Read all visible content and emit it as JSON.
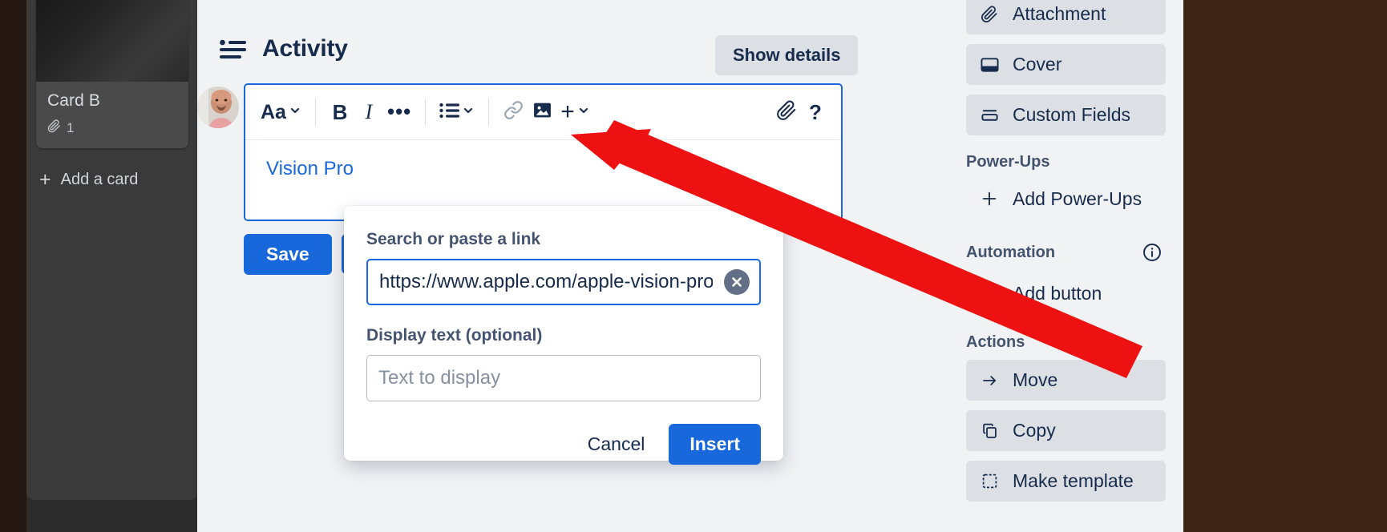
{
  "board": {
    "card": {
      "title": "Card B",
      "attachment_count": "1",
      "attachment_icon": "paperclip-icon"
    },
    "add_card_label": "Add a card",
    "add_icon": "plus-icon"
  },
  "activity": {
    "icon": "activity-list-icon",
    "title": "Activity",
    "show_details_label": "Show details"
  },
  "composer": {
    "avatar_name": "user-avatar",
    "toolbar": {
      "text_style_label": "Aa",
      "bold_label": "B",
      "italic_label": "I",
      "more_label": "•••",
      "list_icon": "bullet-list-icon",
      "link_icon": "link-icon",
      "image_icon": "image-icon",
      "plus_label": "+",
      "attachment_icon": "paperclip-icon",
      "help_label": "?",
      "chevron_icon": "chevron-down-icon"
    },
    "body_text": "Vision Pro",
    "save_label": "Save",
    "confirm_icon": "check-icon"
  },
  "link_popover": {
    "url_label": "Search or paste a link",
    "url_value": "https://www.apple.com/apple-vision-pro/",
    "url_placeholder": "Search or paste a link",
    "clear_icon": "clear-x-icon",
    "display_label": "Display text (optional)",
    "display_value": "",
    "display_placeholder": "Text to display",
    "cancel_label": "Cancel",
    "insert_label": "Insert"
  },
  "sidebar": {
    "items": [
      {
        "label": "Attachment",
        "icon": "paperclip-icon"
      },
      {
        "label": "Cover",
        "icon": "cover-icon"
      },
      {
        "label": "Custom Fields",
        "icon": "custom-fields-icon"
      }
    ],
    "power_ups": {
      "heading": "Power-Ups",
      "add_label": "Add Power-Ups",
      "add_icon": "plus-icon"
    },
    "automation": {
      "heading": "Automation",
      "info_icon": "info-icon",
      "add_label": "Add button",
      "add_icon": "plus-icon"
    },
    "actions": {
      "heading": "Actions",
      "items": [
        {
          "label": "Move",
          "icon": "arrow-right-icon"
        },
        {
          "label": "Copy",
          "icon": "copy-icon"
        },
        {
          "label": "Make template",
          "icon": "template-icon"
        }
      ]
    }
  },
  "annotation": {
    "arrow_color": "#ee1111",
    "arrow_name": "red-pointer-arrow"
  },
  "colors": {
    "accent_blue": "#1868db",
    "panel_bg": "#f1f2f4",
    "chip_bg": "#dcdfe4",
    "text_dark": "#172b4d",
    "text_subtle": "#44546f",
    "board_bg": "#3d2314"
  }
}
